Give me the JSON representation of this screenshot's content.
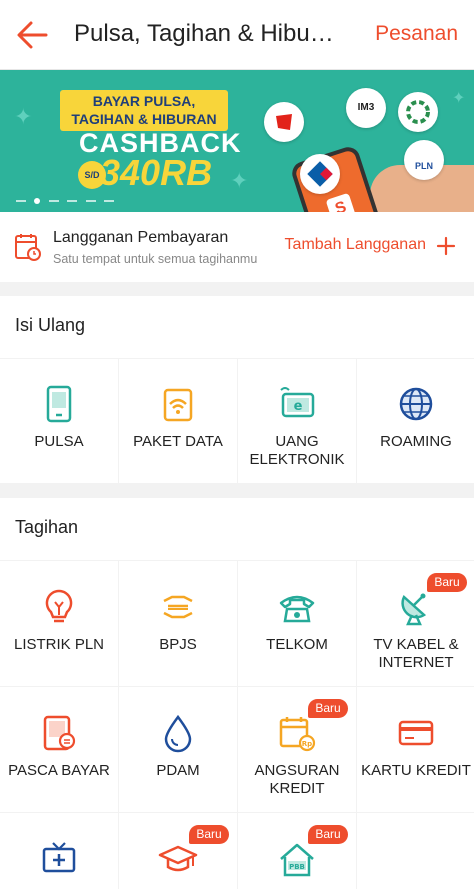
{
  "header": {
    "title": "Pulsa, Tagihan & Hibu…",
    "order_link": "Pesanan"
  },
  "banner": {
    "line1": "BAYAR PULSA,",
    "line2": "TAGIHAN & HIBURAN",
    "cashback": "CASHBACK",
    "sd": "S/D",
    "amount": "340RB",
    "logo_im3": "IM3",
    "logo_pln": "PLN",
    "shop_mark": "S"
  },
  "subscription": {
    "title": "Langganan Pembayaran",
    "description": "Satu tempat untuk semua tagihanmu",
    "add_label": "Tambah Langganan"
  },
  "sections": {
    "topup": {
      "title": "Isi Ulang",
      "items": [
        {
          "label": "PULSA",
          "icon": "phone-icon"
        },
        {
          "label": "PAKET DATA",
          "icon": "wifi-icon"
        },
        {
          "label": "UANG ELEKTRONIK",
          "line1": "UANG",
          "line2": "ELEKTRONIK",
          "icon": "e-money-icon"
        },
        {
          "label": "ROAMING",
          "icon": "globe-icon"
        }
      ]
    },
    "bills": {
      "title": "Tagihan",
      "items": [
        {
          "label": "LISTRIK PLN",
          "icon": "lightbulb-icon"
        },
        {
          "label": "BPJS",
          "icon": "hands-icon"
        },
        {
          "label": "TELKOM",
          "icon": "telephone-icon"
        },
        {
          "line1": "TV KABEL &",
          "line2": "INTERNET",
          "icon": "satellite-icon",
          "badge": "Baru"
        },
        {
          "label": "PASCA BAYAR",
          "icon": "postpaid-phone-icon"
        },
        {
          "label": "PDAM",
          "icon": "water-drop-icon"
        },
        {
          "line1": "ANGSURAN",
          "line2": "KREDIT",
          "icon": "calendar-icon",
          "badge": "Baru"
        },
        {
          "label": "KARTU KREDIT",
          "icon": "credit-card-icon"
        },
        {
          "label": "",
          "icon": "tv-icon"
        },
        {
          "label": "",
          "icon": "graduation-cap-icon",
          "badge": "Baru"
        },
        {
          "label": "",
          "icon": "pbb-house-icon",
          "badge": "Baru",
          "icon_text": "PBB"
        }
      ]
    }
  },
  "colors": {
    "accent": "#ee4d2d",
    "teal": "#26aa99",
    "orange": "#f5a623",
    "blue": "#1f4e9c",
    "banner_bg": "#2db39b"
  }
}
